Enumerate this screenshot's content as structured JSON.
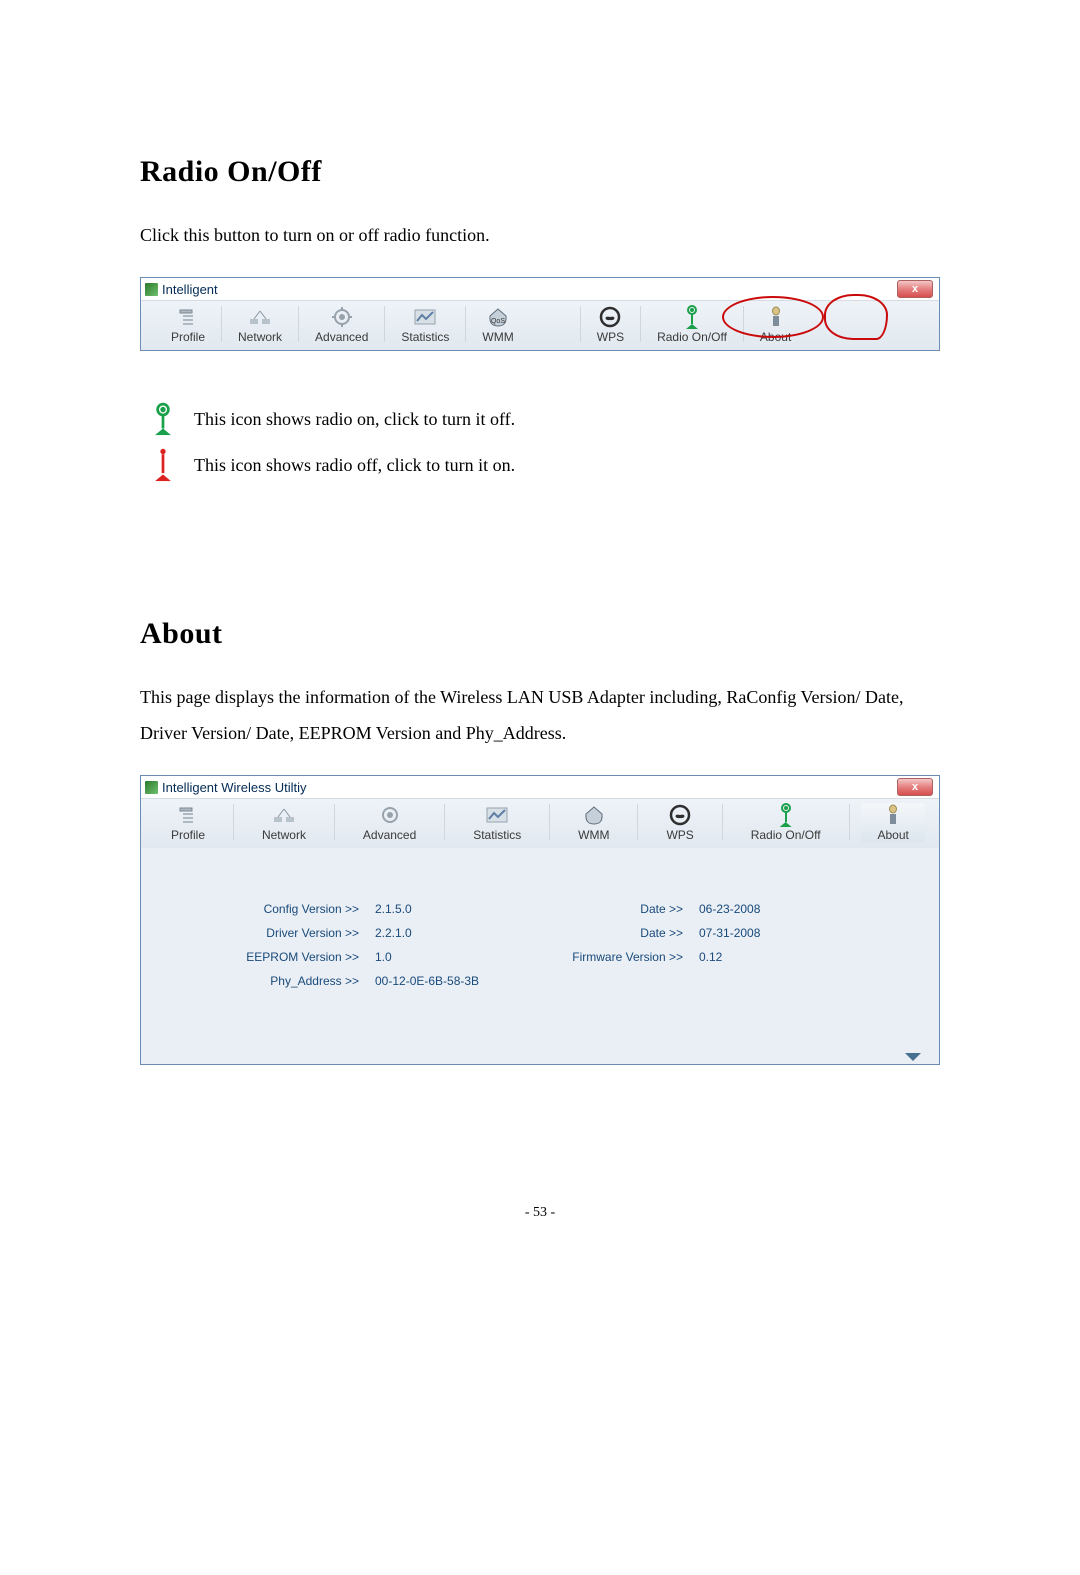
{
  "sections": {
    "radio": {
      "heading": "Radio On/Off",
      "para": "Click this button to turn on or off radio function.",
      "legend_on": "This icon shows radio on, click to turn it off.",
      "legend_off": "This icon shows radio off, click to turn it on."
    },
    "about": {
      "heading": "About",
      "para": "This page displays the information of the Wireless LAN USB Adapter including, RaConfig Version/ Date, Driver Version/ Date, EEPROM Version and Phy_Address."
    }
  },
  "win1": {
    "title": "Intelligent",
    "close": "x"
  },
  "win2": {
    "title": "Intelligent Wireless Utiltiy",
    "close": "x"
  },
  "toolbar": {
    "items": {
      "profile": "Profile",
      "network": "Network",
      "advanced": "Advanced",
      "statistics": "Statistics",
      "wmm": "WMM",
      "wps": "WPS",
      "radio": "Radio On/Off",
      "about": "About"
    }
  },
  "about_info": {
    "rows": [
      {
        "l1": "Config Version >>",
        "v1": "2.1.5.0",
        "l2": "Date >>",
        "v2": "06-23-2008"
      },
      {
        "l1": "Driver Version >>",
        "v1": "2.2.1.0",
        "l2": "Date >>",
        "v2": "07-31-2008"
      },
      {
        "l1": "EEPROM Version >>",
        "v1": "1.0",
        "l2": "Firmware Version >>",
        "v2": "0.12"
      },
      {
        "l1": "Phy_Address >>",
        "v1": "00-12-0E-6B-58-3B",
        "l2": "",
        "v2": ""
      }
    ]
  },
  "page_number": "- 53 -"
}
